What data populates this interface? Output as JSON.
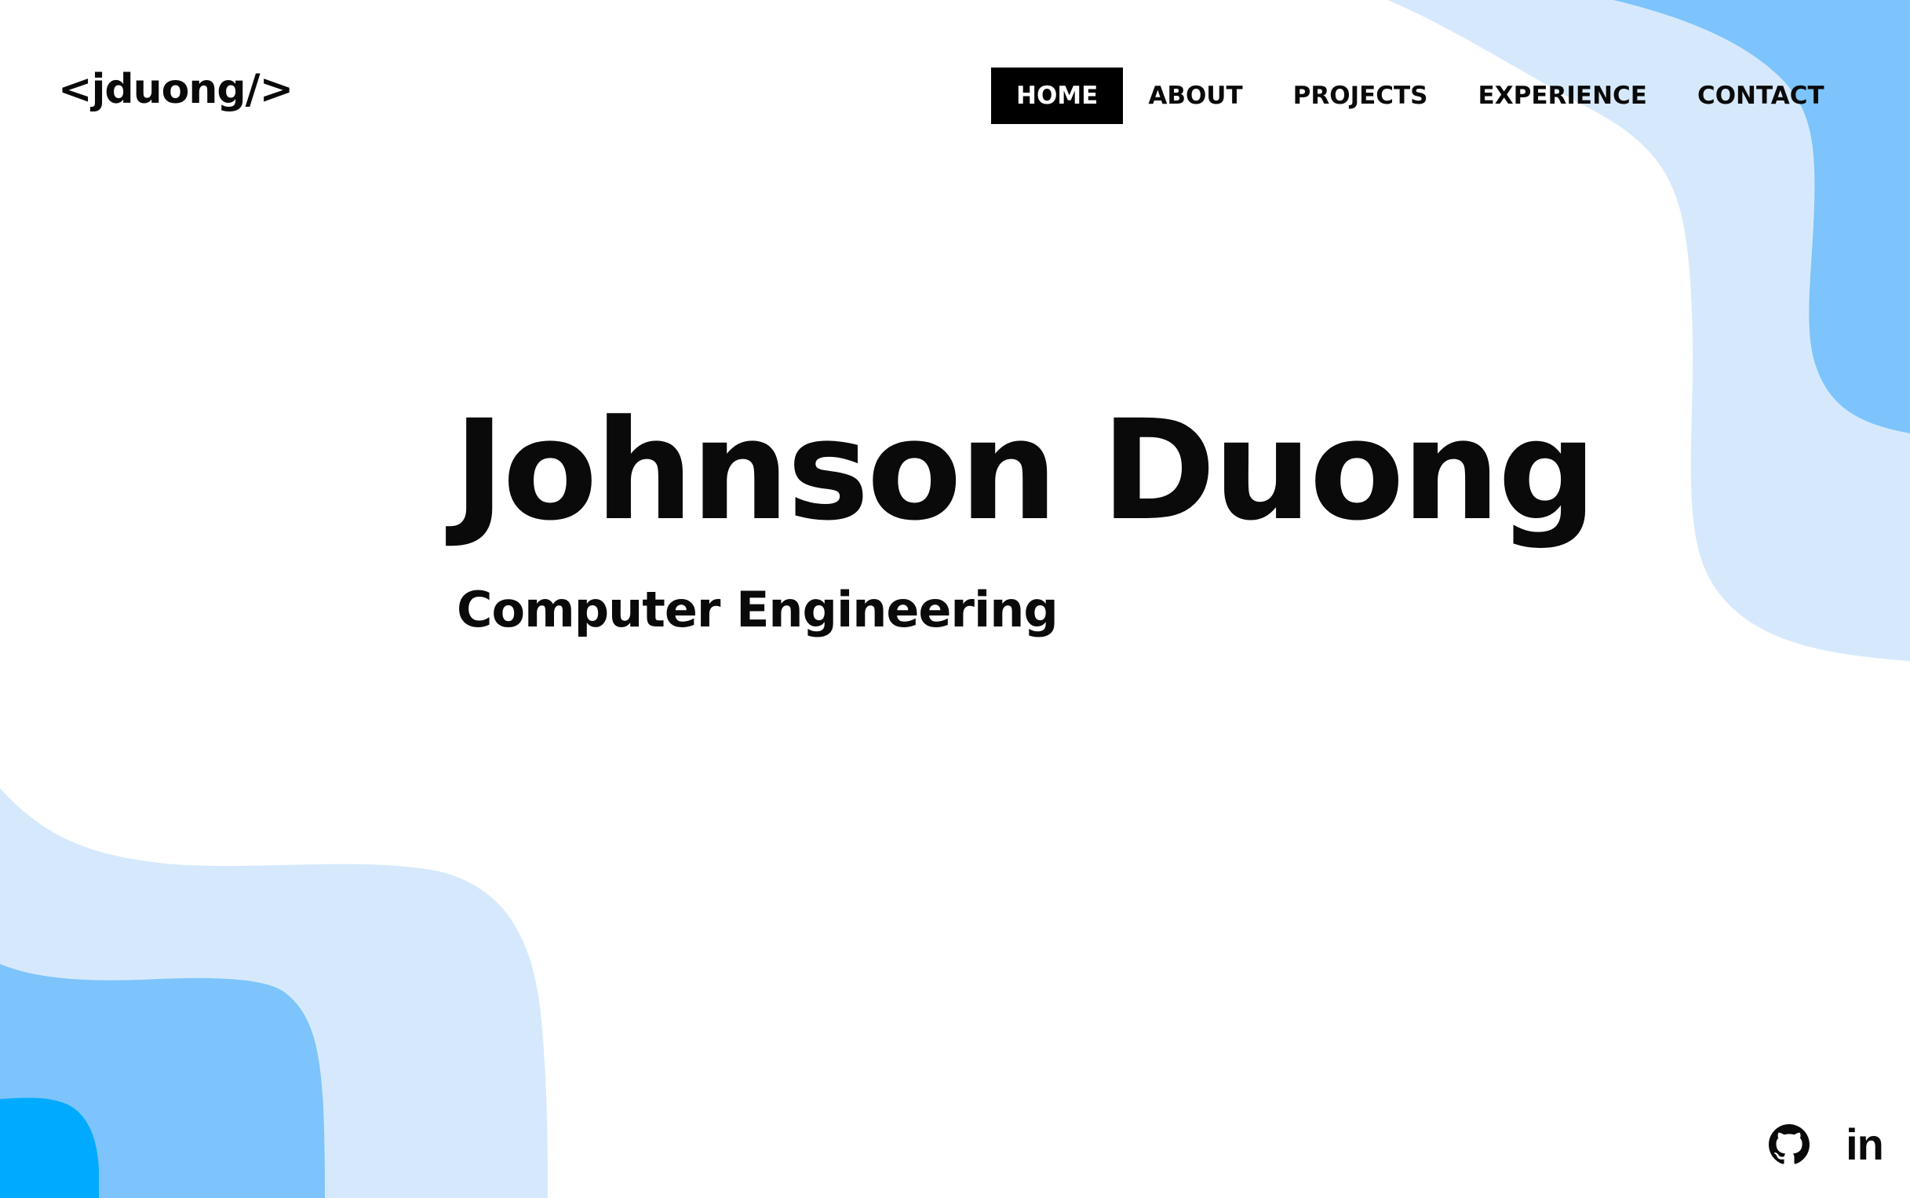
{
  "brand": {
    "logo_text": "<jduong/>"
  },
  "nav": {
    "items": [
      {
        "label": "HOME",
        "active": true
      },
      {
        "label": "ABOUT",
        "active": false
      },
      {
        "label": "PROJECTS",
        "active": false
      },
      {
        "label": "EXPERIENCE",
        "active": false
      },
      {
        "label": "CONTACT",
        "active": false
      }
    ]
  },
  "hero": {
    "name": "Johnson Duong",
    "subtitle": "Computer Engineering"
  },
  "social": {
    "icons": [
      "github-icon",
      "linkedin-icon"
    ],
    "linkedin_glyph": "in"
  },
  "colors": {
    "text": "#0a0a0a",
    "nav_active_bg": "#000000",
    "nav_active_text": "#ffffff",
    "blob_light": "#d6e9fc",
    "blob_mid": "#7cc4fb",
    "blob_dark": "#00aaff"
  }
}
